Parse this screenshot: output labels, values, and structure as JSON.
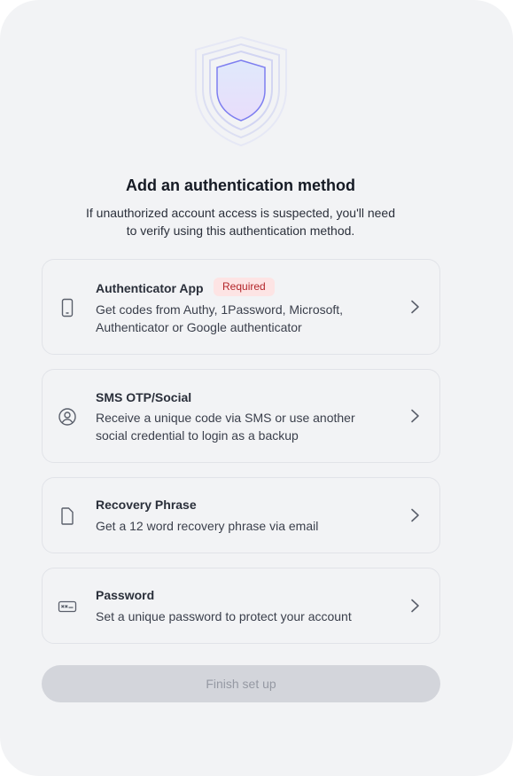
{
  "header": {
    "title": "Add an authentication method",
    "subtitle": "If unauthorized account access is suspected, you'll need to verify using this authentication method."
  },
  "methods": [
    {
      "title": "Authenticator App",
      "badge": "Required",
      "description": "Get codes from Authy, 1Password, Microsoft, Authenticator or Google authenticator",
      "icon": "smartphone-icon"
    },
    {
      "title": "SMS OTP/Social",
      "description": "Receive a unique code via SMS or use another social credential to login as a backup",
      "icon": "user-circle-icon"
    },
    {
      "title": "Recovery Phrase",
      "description": "Get a 12 word recovery phrase via email",
      "icon": "document-icon"
    },
    {
      "title": "Password",
      "description": "Set a unique password to protect your account",
      "icon": "password-field-icon"
    }
  ],
  "footer": {
    "finish_label": "Finish set up"
  },
  "colors": {
    "background": "#f2f3f5",
    "badge_bg": "#fde4e4",
    "badge_text": "#b3262a",
    "disabled_button": "#d3d5db",
    "shield_accent": "#7d7ef0"
  }
}
